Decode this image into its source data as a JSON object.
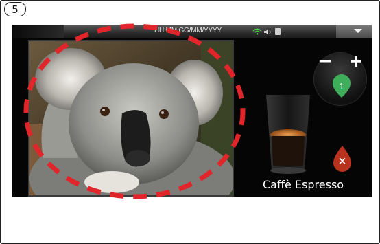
{
  "step_badge": "5",
  "status_bar": {
    "datetime": "HH:MM GG/MM/YYYY",
    "icons": [
      "wifi-icon",
      "speaker-icon",
      "lock-icon"
    ],
    "menu_icon": "chevron-down-icon"
  },
  "photo": {
    "subject": "koala"
  },
  "quantity": {
    "minus_label": "−",
    "plus_label": "+",
    "value": "1"
  },
  "product": {
    "name": "Caffè Espresso"
  },
  "cancel": {
    "label": "×"
  },
  "colors": {
    "accent_green": "#3fae5a",
    "cancel_red": "#b8321e",
    "highlight_red": "#e0262b"
  }
}
